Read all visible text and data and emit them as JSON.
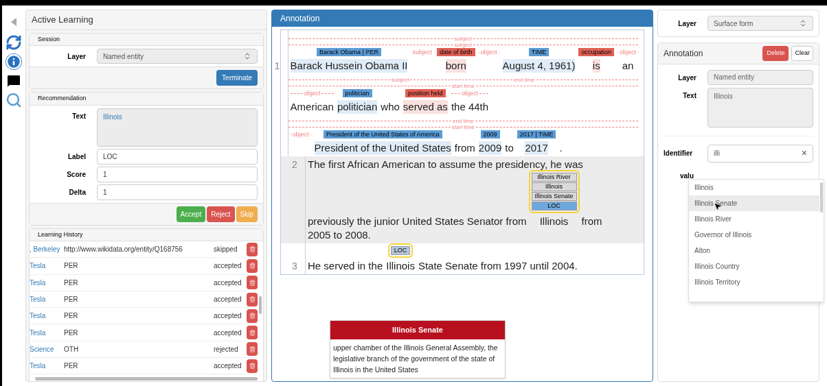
{
  "left_panel": {
    "title": "Active Learning",
    "session": {
      "heading": "Session",
      "layer_label": "Layer",
      "layer_value": "Named entity",
      "terminate_button": "Terminate"
    },
    "recommendation": {
      "heading": "Recommendation",
      "fields": [
        {
          "kind": "textarea",
          "label": "Text",
          "value": "Illinois"
        },
        {
          "kind": "input",
          "label": "Label",
          "value": "LOC"
        },
        {
          "kind": "input",
          "label": "Score",
          "value": "1"
        },
        {
          "kind": "input",
          "label": "Delta",
          "value": "1"
        }
      ],
      "buttons": [
        {
          "label": "Accept",
          "color": "#4cae4c"
        },
        {
          "label": "Reject",
          "color": "#d9534f"
        },
        {
          "label": "Skip",
          "color": "#f0ad4e"
        }
      ]
    },
    "history": {
      "heading": "Learning History",
      "rows": [
        {
          "text": ", Berkeley",
          "label": "http://www.wikidata.org/entity/Q168756",
          "status": "skipped"
        },
        {
          "text": "Tesla",
          "label": "PER",
          "status": "accepted"
        },
        {
          "text": "Tesla",
          "label": "PER",
          "status": "accepted"
        },
        {
          "text": "Tesla",
          "label": "PER",
          "status": "accepted"
        },
        {
          "text": "Tesla",
          "label": "PER",
          "status": "accepted"
        },
        {
          "text": "Tesla",
          "label": "PER",
          "status": "accepted"
        },
        {
          "text": "Science",
          "label": "OTH",
          "status": "rejected"
        },
        {
          "text": "Tesla",
          "label": "PER",
          "status": "accepted"
        }
      ]
    }
  },
  "annotation": {
    "title": "Annotation",
    "sentences": [
      {
        "number": "1",
        "selected": false,
        "lines": [
          {
            "arc_rows": [
              [
                "subject"
              ],
              [
                "subject"
              ]
            ],
            "segments": [
              {
                "tag": {
                  "text": "Barack Obama | PER",
                  "color": "#5b9bd5"
                },
                "text": "Barack Hussein Obama II"
              },
              {
                "relation": "subject"
              },
              {
                "tag": {
                  "text": "date of birth",
                  "color": "#e06055"
                },
                "text": "born"
              },
              {
                "relation": "object"
              },
              {
                "tag": {
                  "text": "TIME",
                  "color": "#5b9bd5"
                },
                "text": "August 4, 1961)"
              },
              {
                "tag": {
                  "text": "occupation",
                  "color": "#e06055"
                },
                "text": "is"
              },
              {
                "relation": "object",
                "text": "an"
              }
            ]
          },
          {
            "arc_rows": [
              [
                "subject",
                "end time"
              ],
              [
                "start time"
              ]
            ],
            "segments": [
              {
                "relation": "object",
                "text": "American"
              },
              {
                "tag": {
                  "text": "politician",
                  "color": "#5b9bd5"
                },
                "text": "politician"
              },
              {
                "text": "who"
              },
              {
                "tag": {
                  "text": "position held",
                  "color": "#e06055"
                },
                "text": "served as"
              },
              {
                "relation": "object",
                "text": "the 44th"
              }
            ]
          },
          {
            "arc_rows": [
              [
                "end time"
              ],
              [
                "start time"
              ]
            ],
            "segments": [
              {
                "relation": "object"
              },
              {
                "tag": {
                  "text": "President of the United States of America",
                  "color": "#5b9bd5"
                },
                "text": "President of the United States"
              },
              {
                "text": "from"
              },
              {
                "tag": {
                  "text": "2009",
                  "color": "#5b9bd5"
                },
                "text": "2009"
              },
              {
                "text": "to"
              },
              {
                "tag": {
                  "text": "2017 | TIME",
                  "color": "#5b9bd5"
                },
                "text": "2017"
              },
              {
                "text": "."
              }
            ]
          }
        ]
      },
      {
        "number": "2",
        "selected": true,
        "lines": [
          {
            "segments": [
              {
                "text": "The first African American to assume the presidency, he was"
              }
            ]
          },
          {
            "segments": [
              {
                "text": "previously the junior United States Senator from"
              },
              {
                "stack": {
                  "highlighted": true,
                  "items": [
                    {
                      "text": "Illinois River",
                      "color": "#d9d9d9"
                    },
                    {
                      "text": "Illinois",
                      "color": "#d9d9d9"
                    },
                    {
                      "text": "Illinois Senate",
                      "color": "#d9d9d9"
                    },
                    {
                      "text": "LOC",
                      "color": "#6fa8dc"
                    }
                  ]
                },
                "text": "Illinois"
              },
              {
                "text": "from"
              }
            ]
          },
          {
            "segments": [
              {
                "text": "2005 to 2008."
              }
            ]
          }
        ]
      },
      {
        "number": "3",
        "selected": false,
        "lines": [
          {
            "segments": [
              {
                "text": "He served in the"
              },
              {
                "stack": {
                  "highlighted": true,
                  "items": [
                    {
                      "text": "LOC",
                      "color": "#b4c7d9"
                    }
                  ]
                },
                "text": "Illinois"
              },
              {
                "text": "State Senate from 1997 until 2004."
              }
            ]
          }
        ]
      }
    ],
    "tooltip": {
      "title": "Illinois Senate",
      "body": "upper chamber of the Illinois General Assembly, the legislative branch of the government of the state of Illinois in the United States"
    }
  },
  "right_panel": {
    "layer_label": "Layer",
    "layer_value": "Surface form",
    "annotation": {
      "title": "Annotation",
      "delete_button": "Delete",
      "clear_button": "Clear",
      "layer_label": "Layer",
      "layer_value": "Named entity",
      "text_label": "Text",
      "text_value": "Illinois",
      "identifier_label": "Identifier",
      "identifier_value": "illi",
      "clear_icon": "×",
      "value_label": "valu",
      "suggestions": [
        {
          "text": "Illinois",
          "selected": false
        },
        {
          "text": "Illinois Senate",
          "selected": true
        },
        {
          "text": "Illinois River",
          "selected": false
        },
        {
          "text": "Governor of Illinois",
          "selected": false
        },
        {
          "text": "Alton",
          "selected": false
        },
        {
          "text": "Illinois Country",
          "selected": false
        },
        {
          "text": "Illinois Territory",
          "selected": false
        }
      ]
    }
  }
}
